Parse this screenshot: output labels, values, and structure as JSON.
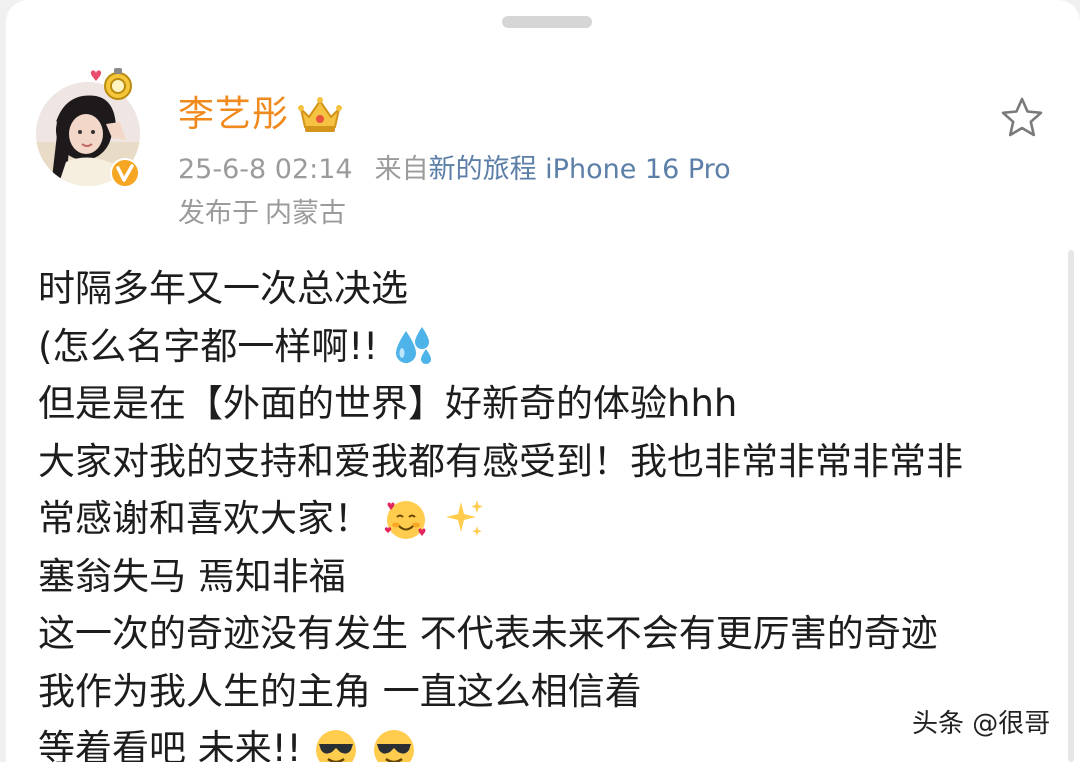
{
  "post": {
    "author": {
      "name": "李艺彤",
      "avatar_icon": "user-avatar",
      "badge_icon": "crown-badge-icon",
      "verified_icon": "verified-v-icon"
    },
    "time": "25-6-8 02:14",
    "source_prefix": "来自",
    "source_device": "新的旅程 iPhone 16 Pro",
    "location_prefix": "发布于",
    "location": "内蒙古",
    "lines": [
      "时隔多年又一次总决选",
      "(怎么名字都一样啊!!",
      "但是是在【外面的世界】好新奇的体验hhh",
      "大家对我的支持和爱我都有感受到！我也非常非常非常非",
      "常感谢和喜欢大家！",
      "塞翁失马 焉知非福",
      "这一次的奇迹没有发生 不代表未来不会有更厉害的奇迹",
      "我作为我人生的主角 一直这么相信着",
      "等着看吧 未来!!"
    ],
    "emojis": {
      "line2": [
        "sweat-droplets-emoji"
      ],
      "line5": [
        "smiling-face-with-hearts-emoji",
        "sparkles-emoji"
      ],
      "line9": [
        "sunglasses-face-emoji",
        "sunglasses-face-emoji"
      ]
    }
  },
  "actions": {
    "favorite_icon": "star-outline-icon"
  },
  "watermark": "头条 @很哥",
  "colors": {
    "username": "#f08a1d",
    "device": "#5c7fa8",
    "meta": "#9b9b9b",
    "text": "#1d1d1d"
  }
}
